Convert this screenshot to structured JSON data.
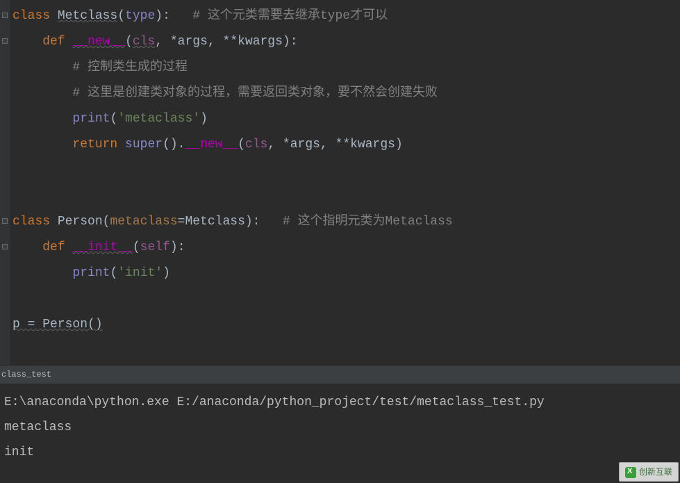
{
  "code": {
    "lines": [
      {
        "raw": "class",
        "parts": [
          {
            "t": "class ",
            "c": "kw"
          },
          {
            "t": "Metclass",
            "c": "cls-name underline"
          },
          {
            "t": "(",
            "c": "paren"
          },
          {
            "t": "type",
            "c": "builtin"
          },
          {
            "t": "):   ",
            "c": "paren"
          },
          {
            "t": "# 这个元类需要去继承type才可以",
            "c": "comment"
          }
        ]
      },
      {
        "parts": [
          {
            "t": "    ",
            "c": ""
          },
          {
            "t": "def ",
            "c": "kw"
          },
          {
            "t": "__new__",
            "c": "special underline"
          },
          {
            "t": "(",
            "c": "paren"
          },
          {
            "t": "cls",
            "c": "self underline"
          },
          {
            "t": ", *args, **kwargs):",
            "c": "paren"
          }
        ]
      },
      {
        "parts": [
          {
            "t": "        ",
            "c": ""
          },
          {
            "t": "# 控制类生成的过程",
            "c": "comment"
          }
        ]
      },
      {
        "parts": [
          {
            "t": "        ",
            "c": ""
          },
          {
            "t": "# 这里是创建类对象的过程，需要返回类对象，要不然会创建失败",
            "c": "comment"
          }
        ]
      },
      {
        "parts": [
          {
            "t": "        ",
            "c": ""
          },
          {
            "t": "print",
            "c": "builtin"
          },
          {
            "t": "(",
            "c": "paren"
          },
          {
            "t": "'metaclass'",
            "c": "string-q"
          },
          {
            "t": ")",
            "c": "paren"
          }
        ]
      },
      {
        "parts": [
          {
            "t": "        ",
            "c": ""
          },
          {
            "t": "return ",
            "c": "kw"
          },
          {
            "t": "super",
            "c": "builtin"
          },
          {
            "t": "().",
            "c": "paren"
          },
          {
            "t": "__new__",
            "c": "special"
          },
          {
            "t": "(",
            "c": "paren"
          },
          {
            "t": "cls",
            "c": "self"
          },
          {
            "t": ", *args, **kwargs)",
            "c": "paren"
          }
        ]
      },
      {
        "parts": [
          {
            "t": "",
            "c": ""
          }
        ]
      },
      {
        "parts": [
          {
            "t": "",
            "c": ""
          }
        ]
      },
      {
        "parts": [
          {
            "t": "class ",
            "c": "kw"
          },
          {
            "t": "Person(",
            "c": "cls-name"
          },
          {
            "t": "metaclass",
            "c": "param"
          },
          {
            "t": "=Metclass):   ",
            "c": "paren"
          },
          {
            "t": "# 这个指明元类为Metaclass",
            "c": "comment"
          }
        ]
      },
      {
        "parts": [
          {
            "t": "    ",
            "c": ""
          },
          {
            "t": "def ",
            "c": "kw"
          },
          {
            "t": "__init__",
            "c": "special underline"
          },
          {
            "t": "(",
            "c": "paren"
          },
          {
            "t": "self",
            "c": "self"
          },
          {
            "t": "):",
            "c": "paren"
          }
        ]
      },
      {
        "parts": [
          {
            "t": "        ",
            "c": ""
          },
          {
            "t": "print",
            "c": "builtin"
          },
          {
            "t": "(",
            "c": "paren"
          },
          {
            "t": "'init'",
            "c": "string-q"
          },
          {
            "t": ")",
            "c": "paren"
          }
        ]
      },
      {
        "parts": [
          {
            "t": "",
            "c": ""
          }
        ]
      },
      {
        "parts": [
          {
            "t": "p = Person()",
            "c": "cls-name underline"
          }
        ]
      }
    ]
  },
  "tab": {
    "label": "class_test"
  },
  "terminal": {
    "lines": [
      "E:\\anaconda\\python.exe E:/anaconda/python_project/test/metaclass_test.py",
      "metaclass",
      "init"
    ]
  },
  "watermark": {
    "text": "创新互联"
  }
}
